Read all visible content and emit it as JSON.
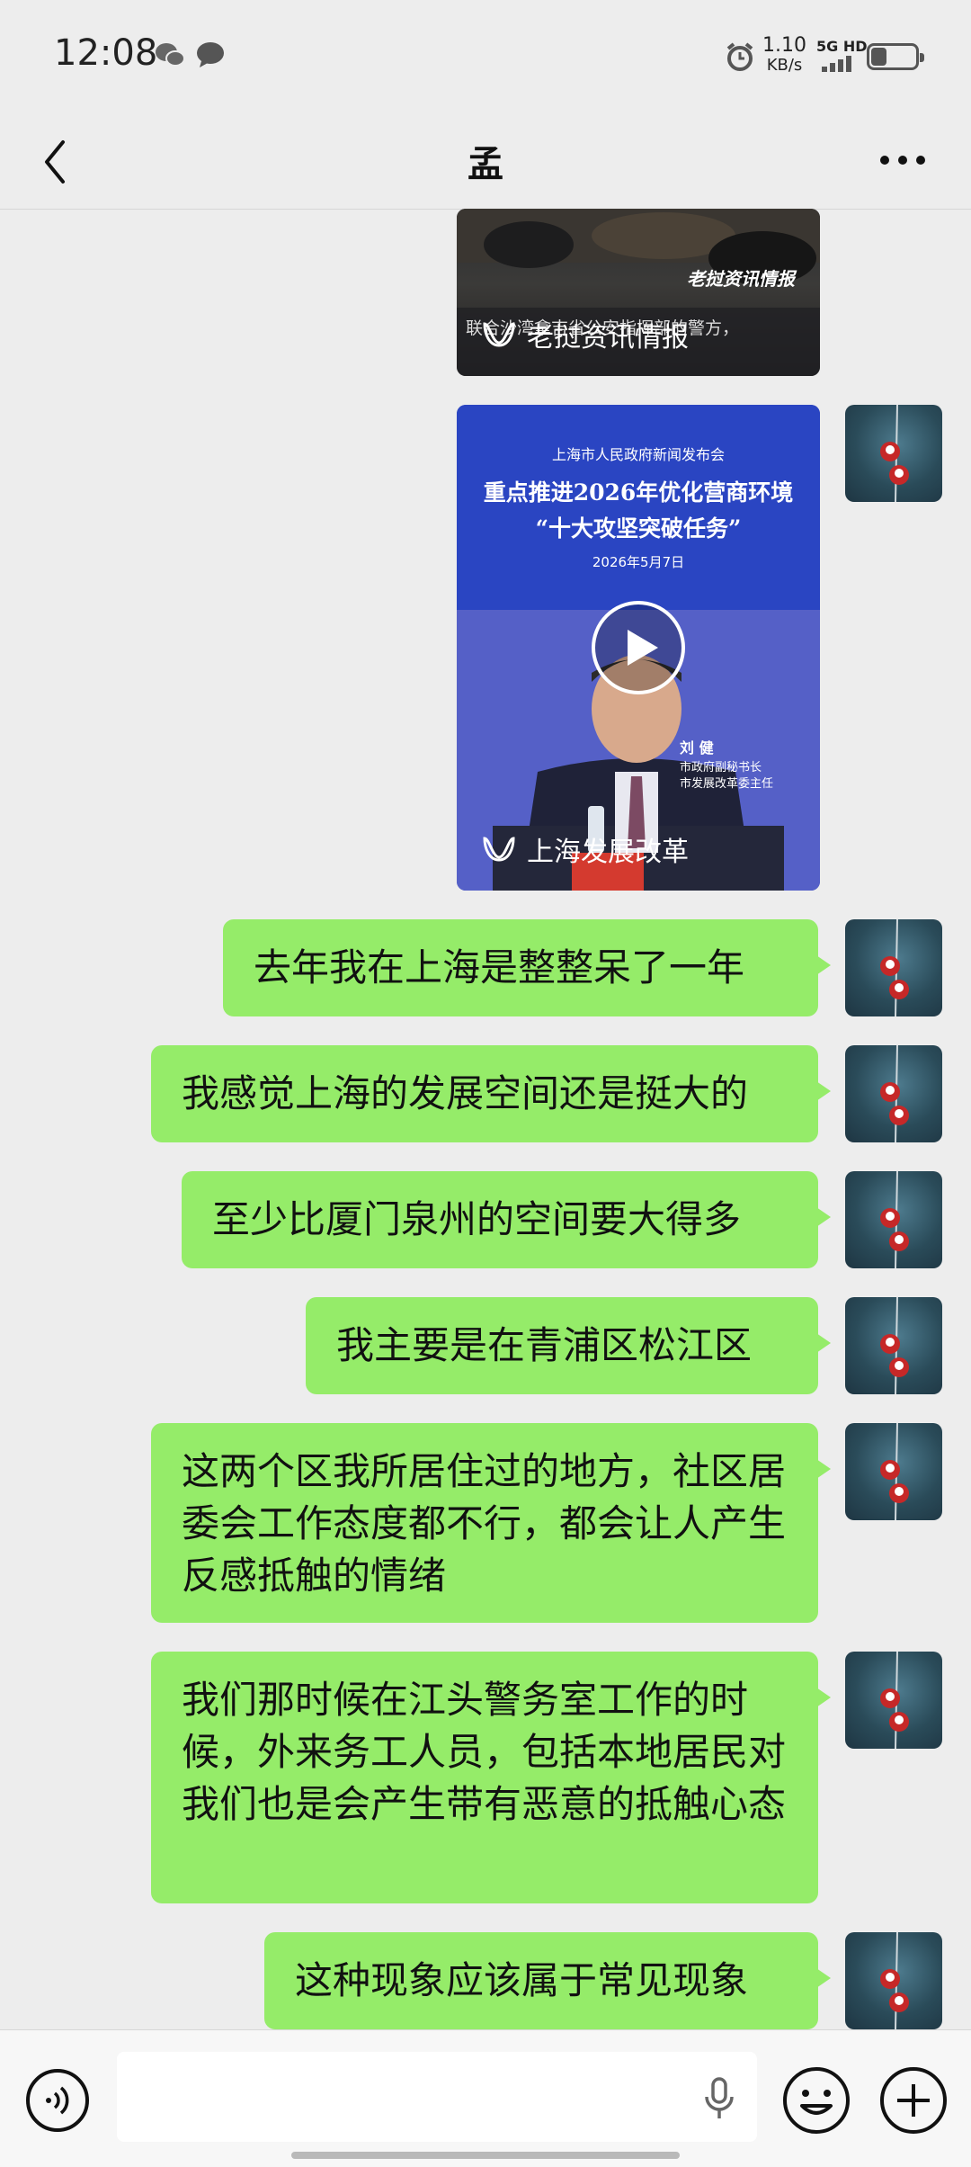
{
  "status_bar": {
    "time": "12:08",
    "net_speed_value": "1.10",
    "net_speed_unit": "KB/s",
    "network": "5G HD",
    "icons": [
      "wechat-icon",
      "message-icon",
      "alarm-icon",
      "signal-icon",
      "battery-icon"
    ],
    "battery_level": 0.35
  },
  "header": {
    "title": "孟",
    "back_icon": "chevron-left-icon",
    "more_icon": "more-dots-icon"
  },
  "videos": [
    {
      "source": "老挝资讯情报",
      "overlay_text": "老挝资讯情报",
      "caption_text": "联合沙湾拿吉省公安指挥部的警方，"
    },
    {
      "source": "上海发展改革",
      "org": "上海市人民政府新闻发布会",
      "headline1": "重点推进2026年优化营商环境",
      "headline2": "“十大攻坚突破任务”",
      "date": "2026年5月7日",
      "speaker_name": "刘 健",
      "speaker_title1": "市政府副秘书长",
      "speaker_title2": "市发展改革委主任"
    }
  ],
  "messages": [
    {
      "text": "去年我在上海是整整呆了一年"
    },
    {
      "text": "我感觉上海的发展空间还是挺大的"
    },
    {
      "text": "至少比厦门泉州的空间要大得多"
    },
    {
      "text": "我主要是在青浦区松江区"
    },
    {
      "text": "这两个区我所居住过的地方，社区居委会工作态度都不行，都会让人产生反感抵触的情绪"
    },
    {
      "text": "我们那时候在江头警务室工作的时候，外来务工人员，包括本地居民对我们也是会产生带有恶意的抵触心态"
    },
    {
      "text": "这种现象应该属于常见现象"
    }
  ],
  "input_bar": {
    "voice_icon": "voice-icon",
    "mic_icon": "mic-icon",
    "emoji_icon": "emoji-icon",
    "plus_icon": "plus-icon"
  },
  "colors": {
    "background": "#ededed",
    "bubble": "#95ec69",
    "video_blue": "#3f4fb8"
  }
}
